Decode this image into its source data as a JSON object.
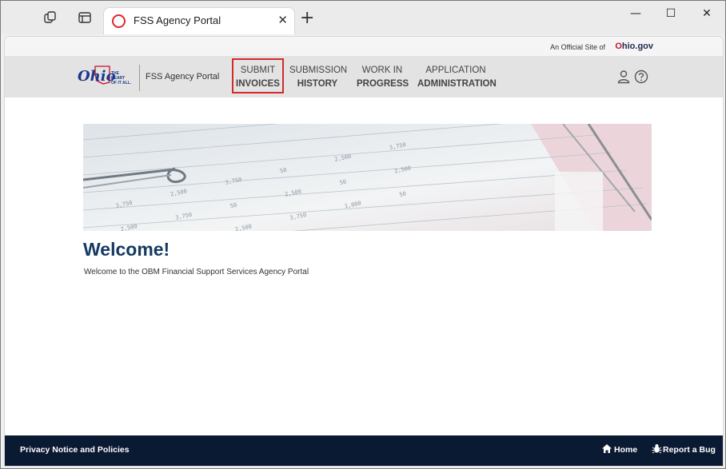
{
  "browser": {
    "tab_title": "FSS Agency Portal",
    "tab_close": "✕",
    "new_tab": "+",
    "controls": {
      "minimize": "—",
      "maximize": "☐",
      "close": "✕"
    }
  },
  "official_bar": {
    "text": "An Official Site of",
    "logo_o": "O",
    "logo_rest": "hio.gov"
  },
  "header": {
    "logo_word": "Ohio",
    "logo_tagline_1": "THE",
    "logo_tagline_2": "HEART",
    "logo_tagline_3": "OF IT ALL.",
    "portal_name": "FSS Agency Portal",
    "nav": [
      {
        "line1": "SUBMIT",
        "line2": "INVOICES"
      },
      {
        "line1": "SUBMISSION",
        "line2": "HISTORY"
      },
      {
        "line1": "WORK IN",
        "line2": "PROGRESS"
      },
      {
        "line1": "APPLICATION",
        "line2": "ADMINISTRATION"
      }
    ],
    "icons": {
      "user": "user-icon",
      "help": "help-icon"
    }
  },
  "main": {
    "title": "Welcome!",
    "subtitle": "Welcome to the OBM Financial Support Services Agency Portal"
  },
  "footer": {
    "privacy": "Privacy Notice and Policies",
    "home": "Home",
    "report_bug": "Report a Bug"
  },
  "colors": {
    "accent_red": "#d42a2a",
    "navy": "#153a63",
    "footer_bg": "#0b1a33"
  }
}
